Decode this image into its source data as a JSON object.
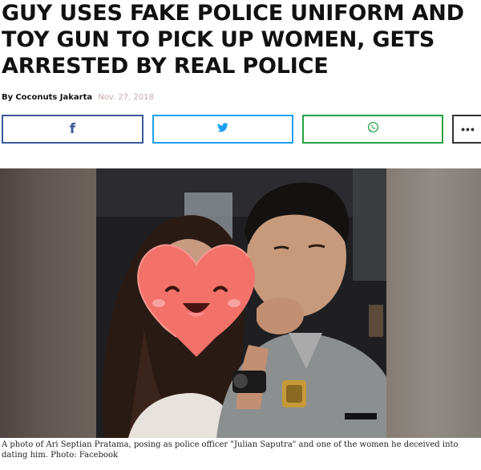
{
  "article": {
    "headline": "GUY USES FAKE POLICE UNIFORM AND TOY GUN TO PICK UP WOMEN, GETS ARRESTED BY REAL POLICE",
    "byline_prefix": "By",
    "author": "Coconuts Jakarta",
    "date": "Nov. 27, 2018"
  },
  "share": {
    "facebook_glyph": "f",
    "twitter_icon": "twitter-bird-icon",
    "whatsapp_icon": "whatsapp-icon",
    "more_glyph": "•••",
    "colors": {
      "facebook": "#3b5998",
      "twitter": "#1da1f2",
      "whatsapp": "#25a244",
      "more": "#333333"
    }
  },
  "photo": {
    "face_cover_icon": "heart-emoji-icon"
  },
  "caption": "A photo of Ari Septian Pratama, posing as police officer \"Julian Saputra\" and one of the women he deceived into dating him. Photo: Facebook"
}
